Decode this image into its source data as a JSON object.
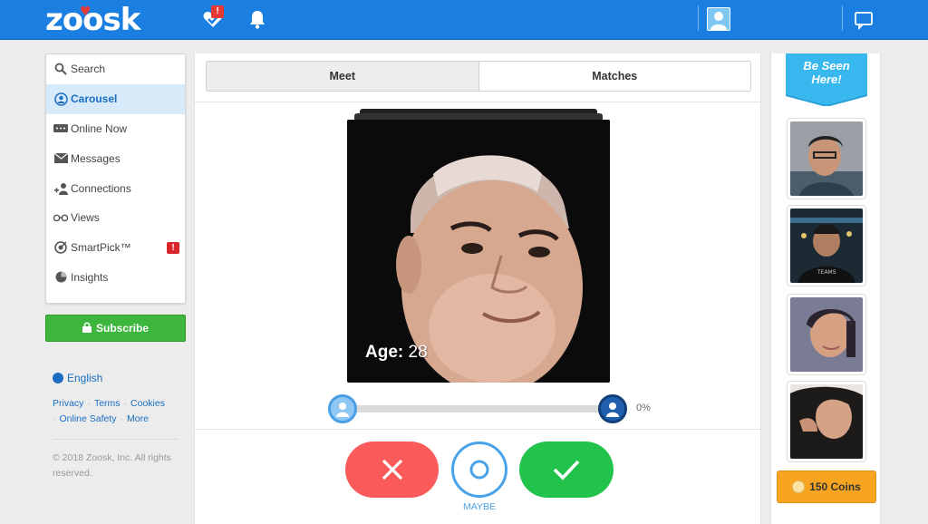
{
  "brand": {
    "logo_text": "zoosk",
    "primary_color": "#1a7fe0"
  },
  "header": {
    "icons": [
      "heart-check-icon",
      "bell-icon",
      "user-avatar-icon",
      "chat-icon"
    ],
    "badge": "!"
  },
  "sidebar": {
    "items": [
      {
        "label": "Search",
        "icon": "search-icon"
      },
      {
        "label": "Carousel",
        "icon": "carousel-icon",
        "active": true
      },
      {
        "label": "Online Now",
        "icon": "chat-bubble-icon"
      },
      {
        "label": "Messages",
        "icon": "envelope-icon"
      },
      {
        "label": "Connections",
        "icon": "connections-icon"
      },
      {
        "label": "Views",
        "icon": "glasses-icon"
      },
      {
        "label": "SmartPick™",
        "icon": "target-icon",
        "badge": "!"
      },
      {
        "label": "Insights",
        "icon": "pie-chart-icon"
      }
    ],
    "subscribe_label": "Subscribe",
    "language": "English",
    "links": [
      "Privacy",
      "Terms",
      "Cookies",
      "Online Safety",
      "More"
    ],
    "copyright": "© 2018 Zoosk, Inc. All rights reserved."
  },
  "main": {
    "tabs": [
      {
        "label": "Meet",
        "active": true
      },
      {
        "label": "Matches"
      }
    ],
    "profile": {
      "age_label": "Age:",
      "age_value": "28"
    },
    "match_percent": "0%",
    "maybe_label": "MAYBE"
  },
  "right": {
    "be_seen_line1": "Be Seen",
    "be_seen_line2": "Here!",
    "coins_label": "150 Coins"
  }
}
